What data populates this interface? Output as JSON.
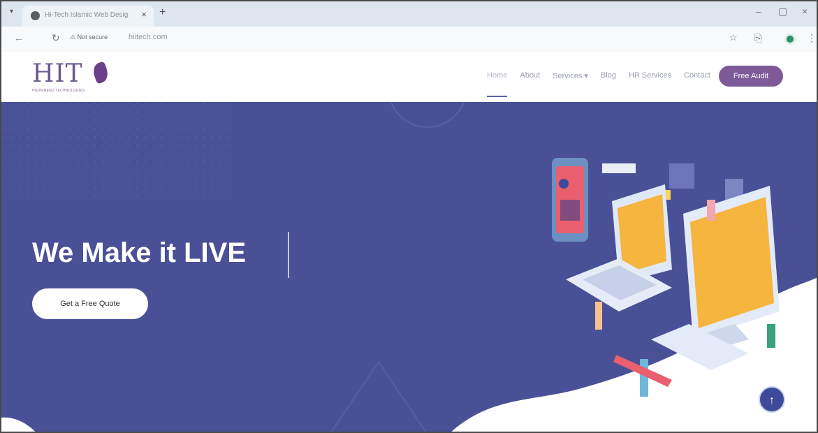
{
  "browser": {
    "tab_title": "Hi-Tech Islamic Web Design Company",
    "tab_close": "×",
    "new_tab": "+",
    "security_label": "Not secure",
    "url": "hiitech.com",
    "window_controls": [
      "–",
      "▢",
      "×"
    ]
  },
  "site": {
    "logo": {
      "text": "HIT",
      "tagline": "HIGHEREND TECHNOLOGIES"
    },
    "nav": {
      "items": [
        "Home",
        "About",
        "Services ▾",
        "Blog",
        "HR Services",
        "Contact"
      ],
      "active_index": 0
    },
    "cta_label": "Free Audit"
  },
  "hero": {
    "title": "We  Make it LIVE",
    "button_label": "Get a Free Quote",
    "scroll_top_icon": "↑"
  },
  "colors": {
    "hero_bg": "#4a5096",
    "accent": "#7e5a98",
    "wave": "#ffffff"
  }
}
